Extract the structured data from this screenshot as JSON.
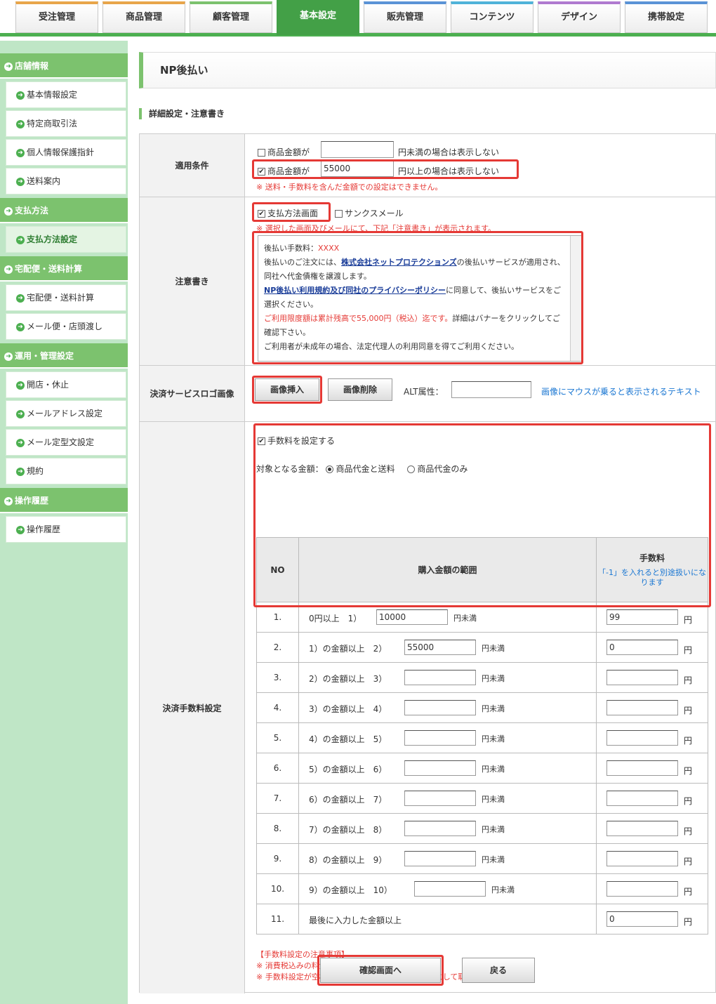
{
  "tabs": [
    "受注管理",
    "商品管理",
    "顧客管理",
    "基本設定",
    "販売管理",
    "コンテンツ",
    "デザイン",
    "携帯設定"
  ],
  "active_tab": "基本設定",
  "tab_accent_colors": [
    "#e8a54a",
    "#e8a54a",
    "#7cc26e",
    "#43a047",
    "#5a93d6",
    "#4fb3d9",
    "#b07ad0",
    "#5a93d6"
  ],
  "sidebar": {
    "sections": [
      {
        "title": "店舗情報",
        "items": [
          "基本情報設定",
          "特定商取引法",
          "個人情報保護指針",
          "送料案内"
        ]
      },
      {
        "title": "支払方法",
        "items": [
          "支払方法設定"
        ]
      },
      {
        "title": "宅配便・送料計算",
        "items": [
          "宅配便・送料計算",
          "メール便・店頭渡し"
        ]
      },
      {
        "title": "運用・管理設定",
        "items": [
          "開店・休止",
          "メールアドレス設定",
          "メール定型文設定",
          "規約"
        ]
      },
      {
        "title": "操作履歴",
        "items": [
          "操作履歴"
        ]
      }
    ],
    "current_item": "支払方法設定"
  },
  "page": {
    "title": "NP後払い",
    "section_title": "詳細設定・注意書き"
  },
  "apply": {
    "label": "適用条件",
    "row1_pre": "商品金額が",
    "row1_value": "",
    "row1_post": "円未満の場合は表示しない",
    "row2_pre": "商品金額が",
    "row2_value": "55000",
    "row2_post": "円以上の場合は表示しない",
    "note": "※ 送料・手数料を含んだ金額での設定はできません。"
  },
  "notice": {
    "label": "注意書き",
    "opt1": "支払方法画面",
    "opt2": "サンクスメール",
    "note": "※ 選択した画面及びメールにて、下記「注意書き」が表示されます。",
    "text": {
      "line1": "後払い手数料：",
      "line1_red": "XXXX",
      "line2_pre": "後払いのご注文には、",
      "line2_link": "株式会社ネットプロテクションズ",
      "line2_post": "の後払いサービスが適用され、同社へ代金債権を譲渡します。",
      "line3_link": "NP後払い利用規約及び同社のプライバシーポリシー",
      "line3_post": "に同意して、後払いサービスをご選択ください。",
      "line4_red": "ご利用限度額は累計残高で55,000円（税込）迄です。",
      "line4_post": "詳細はバナーをクリックしてご確認下さい。",
      "line5": "ご利用者が未成年の場合、法定代理人の利用同意を得てご利用ください。"
    }
  },
  "logo": {
    "label": "決済サービスロゴ画像",
    "insert": "画像挿入",
    "delete": "画像削除",
    "alt_label": "ALT属性：",
    "alt_value": "",
    "hint": "画像にマウスが乗ると表示されるテキスト"
  },
  "fee": {
    "label": "決済手数料設定",
    "enable": "手数料を設定する",
    "target_label": "対象となる金額：",
    "target_opt1": "商品代金と送料",
    "target_opt2": "商品代金のみ",
    "headers": {
      "no": "NO",
      "range": "購入金額の範囲",
      "fee": "手数料",
      "fee_hint": "「-1」を入れると別途扱いになります"
    },
    "unit_lt": "円未満",
    "unit_yen": "円",
    "rows": [
      {
        "no": "1.",
        "from": "0円以上　1）",
        "amount": "10000",
        "fee": "99"
      },
      {
        "no": "2.",
        "from": "1）の金額以上　2）",
        "amount": "55000",
        "fee": "0"
      },
      {
        "no": "3.",
        "from": "2）の金額以上　3）",
        "amount": "",
        "fee": ""
      },
      {
        "no": "4.",
        "from": "3）の金額以上　4）",
        "amount": "",
        "fee": ""
      },
      {
        "no": "5.",
        "from": "4）の金額以上　5）",
        "amount": "",
        "fee": ""
      },
      {
        "no": "6.",
        "from": "5）の金額以上　6）",
        "amount": "",
        "fee": ""
      },
      {
        "no": "7.",
        "from": "6）の金額以上　7）",
        "amount": "",
        "fee": ""
      },
      {
        "no": "8.",
        "from": "7）の金額以上　8）",
        "amount": "",
        "fee": ""
      },
      {
        "no": "9.",
        "from": "8）の金額以上　9）",
        "amount": "",
        "fee": ""
      },
      {
        "no": "10.",
        "from": "9）の金額以上　10）",
        "amount": "",
        "fee": ""
      },
      {
        "no": "11.",
        "from": "最後に入力した金額以上",
        "amount": null,
        "fee": "0"
      }
    ],
    "notes_title": "【手数料設定の注意事項】",
    "note1": "※ 消費税込みの料金を入力してください。",
    "note2": "※ 手数料設定が空欄・未完了の場合設定は無いものとして取り扱われます。"
  },
  "buttons": {
    "confirm": "確認画面へ",
    "back": "戻る"
  },
  "colors": {
    "brand_green": "#4caf50",
    "sidebar_bg": "#bfe6c6",
    "highlight_red": "#e53935",
    "link_blue": "#1a3d99"
  }
}
